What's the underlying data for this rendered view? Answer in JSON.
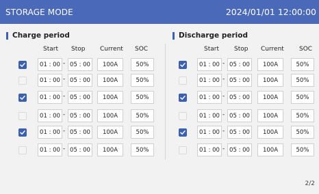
{
  "header": {
    "title": "STORAGE MODE",
    "datetime": "2024/01/01 12:00:00"
  },
  "charge": {
    "title": "Charge period",
    "columns": {
      "start": "Start",
      "stop": "Stop",
      "current": "Current",
      "soc": "SOC"
    },
    "rows": [
      {
        "enabled": true,
        "start": "01 : 00",
        "stop": "05 : 00",
        "current": "100A",
        "soc": "50%"
      },
      {
        "enabled": false,
        "start": "01 : 00",
        "stop": "05 : 00",
        "current": "100A",
        "soc": "50%"
      },
      {
        "enabled": true,
        "start": "01 : 00",
        "stop": "05 : 00",
        "current": "100A",
        "soc": "50%"
      },
      {
        "enabled": false,
        "start": "01 : 00",
        "stop": "05 : 00",
        "current": "100A",
        "soc": "50%"
      },
      {
        "enabled": true,
        "start": "01 : 00",
        "stop": "05 : 00",
        "current": "100A",
        "soc": "50%"
      },
      {
        "enabled": false,
        "start": "01 : 00",
        "stop": "05 : 00",
        "current": "100A",
        "soc": "50%"
      }
    ]
  },
  "discharge": {
    "title": "Discharge period",
    "columns": {
      "start": "Start",
      "stop": "Stop",
      "current": "Current",
      "soc": "SOC"
    },
    "rows": [
      {
        "enabled": true,
        "start": "01 : 00",
        "stop": "05 : 00",
        "current": "100A",
        "soc": "50%"
      },
      {
        "enabled": false,
        "start": "01 : 00",
        "stop": "05 : 00",
        "current": "100A",
        "soc": "50%"
      },
      {
        "enabled": true,
        "start": "01 : 00",
        "stop": "05 : 00",
        "current": "100A",
        "soc": "50%"
      },
      {
        "enabled": false,
        "start": "01 : 00",
        "stop": "05 : 00",
        "current": "100A",
        "soc": "50%"
      },
      {
        "enabled": true,
        "start": "01 : 00",
        "stop": "05 : 00",
        "current": "100A",
        "soc": "50%"
      },
      {
        "enabled": false,
        "start": "01 : 00",
        "stop": "05 : 00",
        "current": "100A",
        "soc": "50%"
      }
    ]
  },
  "range_separator": "-",
  "pagination": "2/2",
  "colors": {
    "header_bg": "#4a69b8",
    "accent": "#3d5fb0",
    "background": "#f2f2f2"
  },
  "icons": {
    "checked": "check-icon"
  }
}
